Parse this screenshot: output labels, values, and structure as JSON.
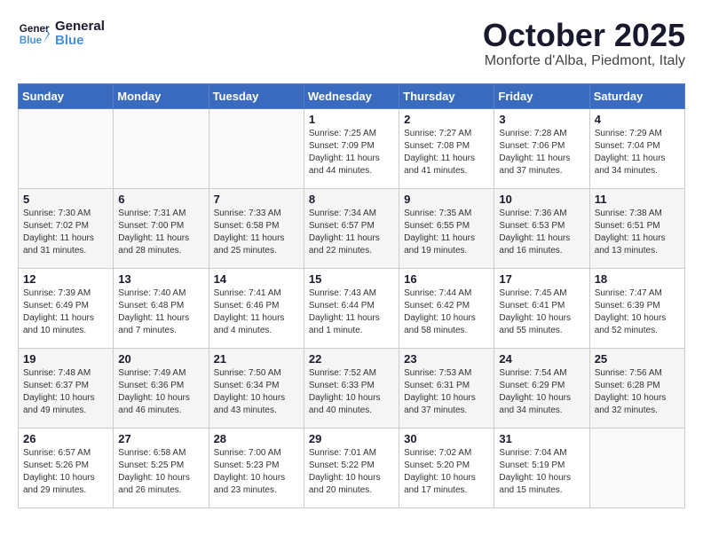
{
  "header": {
    "logo_line1": "General",
    "logo_line2": "Blue",
    "month": "October 2025",
    "location": "Monforte d'Alba, Piedmont, Italy"
  },
  "weekdays": [
    "Sunday",
    "Monday",
    "Tuesday",
    "Wednesday",
    "Thursday",
    "Friday",
    "Saturday"
  ],
  "weeks": [
    [
      {
        "day": "",
        "info": ""
      },
      {
        "day": "",
        "info": ""
      },
      {
        "day": "",
        "info": ""
      },
      {
        "day": "1",
        "info": "Sunrise: 7:25 AM\nSunset: 7:09 PM\nDaylight: 11 hours\nand 44 minutes."
      },
      {
        "day": "2",
        "info": "Sunrise: 7:27 AM\nSunset: 7:08 PM\nDaylight: 11 hours\nand 41 minutes."
      },
      {
        "day": "3",
        "info": "Sunrise: 7:28 AM\nSunset: 7:06 PM\nDaylight: 11 hours\nand 37 minutes."
      },
      {
        "day": "4",
        "info": "Sunrise: 7:29 AM\nSunset: 7:04 PM\nDaylight: 11 hours\nand 34 minutes."
      }
    ],
    [
      {
        "day": "5",
        "info": "Sunrise: 7:30 AM\nSunset: 7:02 PM\nDaylight: 11 hours\nand 31 minutes."
      },
      {
        "day": "6",
        "info": "Sunrise: 7:31 AM\nSunset: 7:00 PM\nDaylight: 11 hours\nand 28 minutes."
      },
      {
        "day": "7",
        "info": "Sunrise: 7:33 AM\nSunset: 6:58 PM\nDaylight: 11 hours\nand 25 minutes."
      },
      {
        "day": "8",
        "info": "Sunrise: 7:34 AM\nSunset: 6:57 PM\nDaylight: 11 hours\nand 22 minutes."
      },
      {
        "day": "9",
        "info": "Sunrise: 7:35 AM\nSunset: 6:55 PM\nDaylight: 11 hours\nand 19 minutes."
      },
      {
        "day": "10",
        "info": "Sunrise: 7:36 AM\nSunset: 6:53 PM\nDaylight: 11 hours\nand 16 minutes."
      },
      {
        "day": "11",
        "info": "Sunrise: 7:38 AM\nSunset: 6:51 PM\nDaylight: 11 hours\nand 13 minutes."
      }
    ],
    [
      {
        "day": "12",
        "info": "Sunrise: 7:39 AM\nSunset: 6:49 PM\nDaylight: 11 hours\nand 10 minutes."
      },
      {
        "day": "13",
        "info": "Sunrise: 7:40 AM\nSunset: 6:48 PM\nDaylight: 11 hours\nand 7 minutes."
      },
      {
        "day": "14",
        "info": "Sunrise: 7:41 AM\nSunset: 6:46 PM\nDaylight: 11 hours\nand 4 minutes."
      },
      {
        "day": "15",
        "info": "Sunrise: 7:43 AM\nSunset: 6:44 PM\nDaylight: 11 hours\nand 1 minute."
      },
      {
        "day": "16",
        "info": "Sunrise: 7:44 AM\nSunset: 6:42 PM\nDaylight: 10 hours\nand 58 minutes."
      },
      {
        "day": "17",
        "info": "Sunrise: 7:45 AM\nSunset: 6:41 PM\nDaylight: 10 hours\nand 55 minutes."
      },
      {
        "day": "18",
        "info": "Sunrise: 7:47 AM\nSunset: 6:39 PM\nDaylight: 10 hours\nand 52 minutes."
      }
    ],
    [
      {
        "day": "19",
        "info": "Sunrise: 7:48 AM\nSunset: 6:37 PM\nDaylight: 10 hours\nand 49 minutes."
      },
      {
        "day": "20",
        "info": "Sunrise: 7:49 AM\nSunset: 6:36 PM\nDaylight: 10 hours\nand 46 minutes."
      },
      {
        "day": "21",
        "info": "Sunrise: 7:50 AM\nSunset: 6:34 PM\nDaylight: 10 hours\nand 43 minutes."
      },
      {
        "day": "22",
        "info": "Sunrise: 7:52 AM\nSunset: 6:33 PM\nDaylight: 10 hours\nand 40 minutes."
      },
      {
        "day": "23",
        "info": "Sunrise: 7:53 AM\nSunset: 6:31 PM\nDaylight: 10 hours\nand 37 minutes."
      },
      {
        "day": "24",
        "info": "Sunrise: 7:54 AM\nSunset: 6:29 PM\nDaylight: 10 hours\nand 34 minutes."
      },
      {
        "day": "25",
        "info": "Sunrise: 7:56 AM\nSunset: 6:28 PM\nDaylight: 10 hours\nand 32 minutes."
      }
    ],
    [
      {
        "day": "26",
        "info": "Sunrise: 6:57 AM\nSunset: 5:26 PM\nDaylight: 10 hours\nand 29 minutes."
      },
      {
        "day": "27",
        "info": "Sunrise: 6:58 AM\nSunset: 5:25 PM\nDaylight: 10 hours\nand 26 minutes."
      },
      {
        "day": "28",
        "info": "Sunrise: 7:00 AM\nSunset: 5:23 PM\nDaylight: 10 hours\nand 23 minutes."
      },
      {
        "day": "29",
        "info": "Sunrise: 7:01 AM\nSunset: 5:22 PM\nDaylight: 10 hours\nand 20 minutes."
      },
      {
        "day": "30",
        "info": "Sunrise: 7:02 AM\nSunset: 5:20 PM\nDaylight: 10 hours\nand 17 minutes."
      },
      {
        "day": "31",
        "info": "Sunrise: 7:04 AM\nSunset: 5:19 PM\nDaylight: 10 hours\nand 15 minutes."
      },
      {
        "day": "",
        "info": ""
      }
    ]
  ]
}
